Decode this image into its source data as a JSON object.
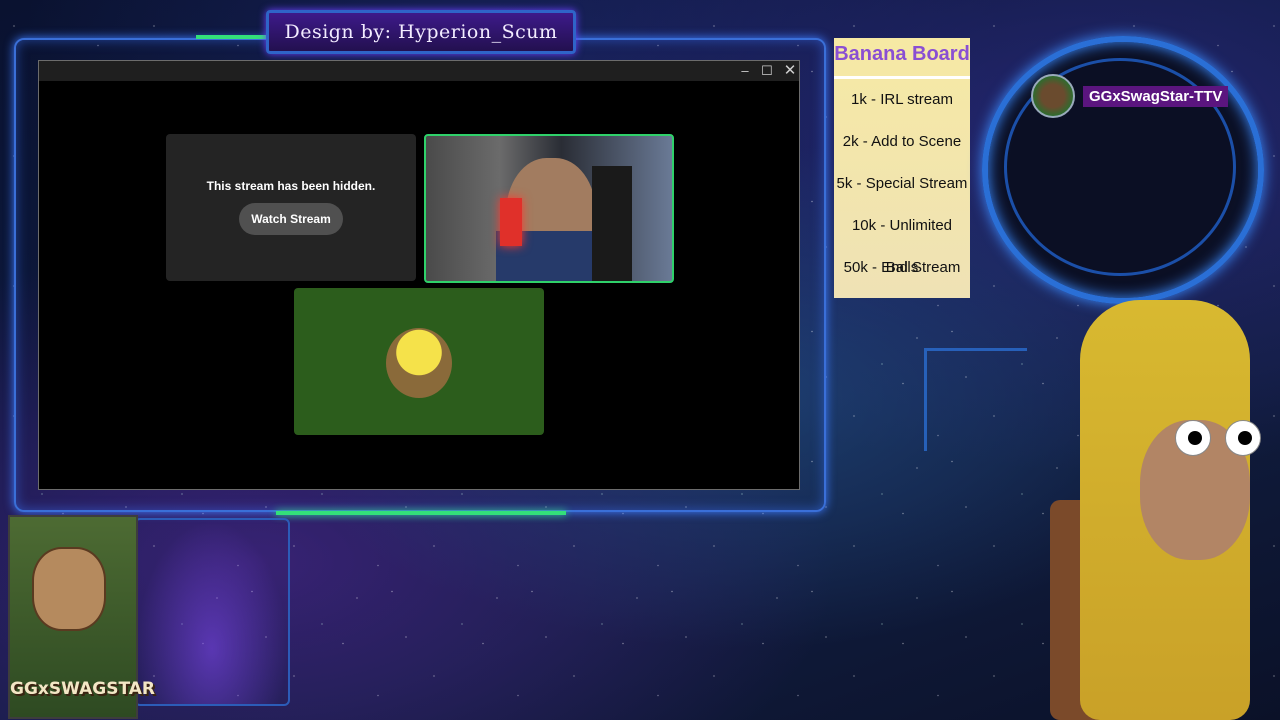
{
  "overlay": {
    "design_credit": "Design by: Hyperion_Scum"
  },
  "window": {
    "controls": {
      "minimize": "–",
      "maximize": "☐",
      "close": "✕"
    },
    "hidden_tile": {
      "message": "This stream has been hidden.",
      "button_label": "Watch Stream"
    }
  },
  "banana_board": {
    "title": "Banana Board",
    "items": [
      "1k - IRL stream",
      "2k - Add to Scene",
      "5k - Special Stream",
      "10k - Unlimited Balls",
      "50k - End Stream"
    ]
  },
  "streamer": {
    "display_name": "GGxSwagStar-TTV"
  },
  "logo": {
    "text": "GGxSWAGSTAR"
  },
  "colors": {
    "accent_green": "#2fd16a",
    "frame_blue": "#3a6fd8",
    "banner_purple": "#3d1a8a",
    "board_title": "#8a4fd3"
  }
}
